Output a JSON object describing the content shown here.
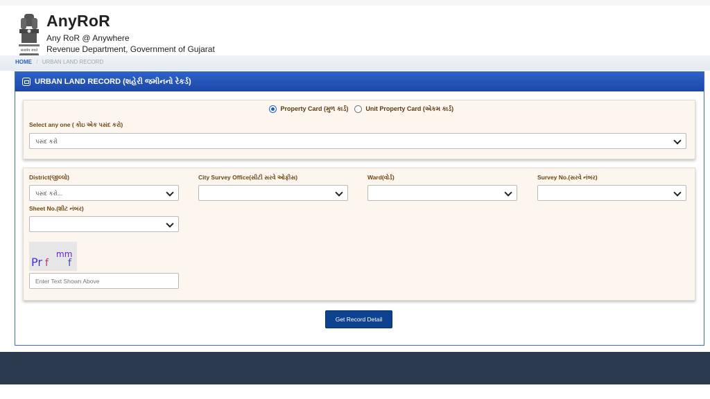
{
  "header": {
    "title": "AnyRoR",
    "subtitle": "Any RoR @ Anywhere",
    "department": "Revenue Department, Government of Gujarat",
    "emblem_icon": "ashoka-emblem-icon"
  },
  "breadcrumb": {
    "home": "HOME",
    "separator": "/",
    "current": "URBAN LAND RECORD"
  },
  "panel": {
    "title": "URBAN LAND RECORD (શહેરી જમીનનો રેકર્ડ)",
    "title_icon": "document-icon"
  },
  "record_type": {
    "options": [
      {
        "label": "Property Card (મુળ કાર્ડ)",
        "selected": true
      },
      {
        "label": "Unit Property Card (એકમ કાર્ડ)",
        "selected": false
      }
    ],
    "select_label": "Select any one ( કોઇ એક પસંદ કરો)",
    "select_value": "પસંદ કરો"
  },
  "filters": {
    "district": {
      "label": "District(જીલ્લો)",
      "value": "પસંદ કરો..."
    },
    "city_survey_office": {
      "label": "City Survey Office(સીટી સરવે ઓફીસ)",
      "value": ""
    },
    "ward": {
      "label": "Ward(વોર્ડ)",
      "value": ""
    },
    "survey_no": {
      "label": "Survey No.(સરવે નંબર)",
      "value": ""
    },
    "sheet_no": {
      "label": "Sheet No.(શીટ નંબર)",
      "value": ""
    }
  },
  "captcha": {
    "text": "Prf mmf",
    "input_placeholder": "Enter Text Shown Above"
  },
  "submit_label": "Get Record Detail",
  "colors": {
    "panel_header": "#2352b8",
    "box_background": "#fdf6ee",
    "label_text": "#6b4512",
    "button": "#0d4290",
    "footer": "#2b3a4d"
  }
}
